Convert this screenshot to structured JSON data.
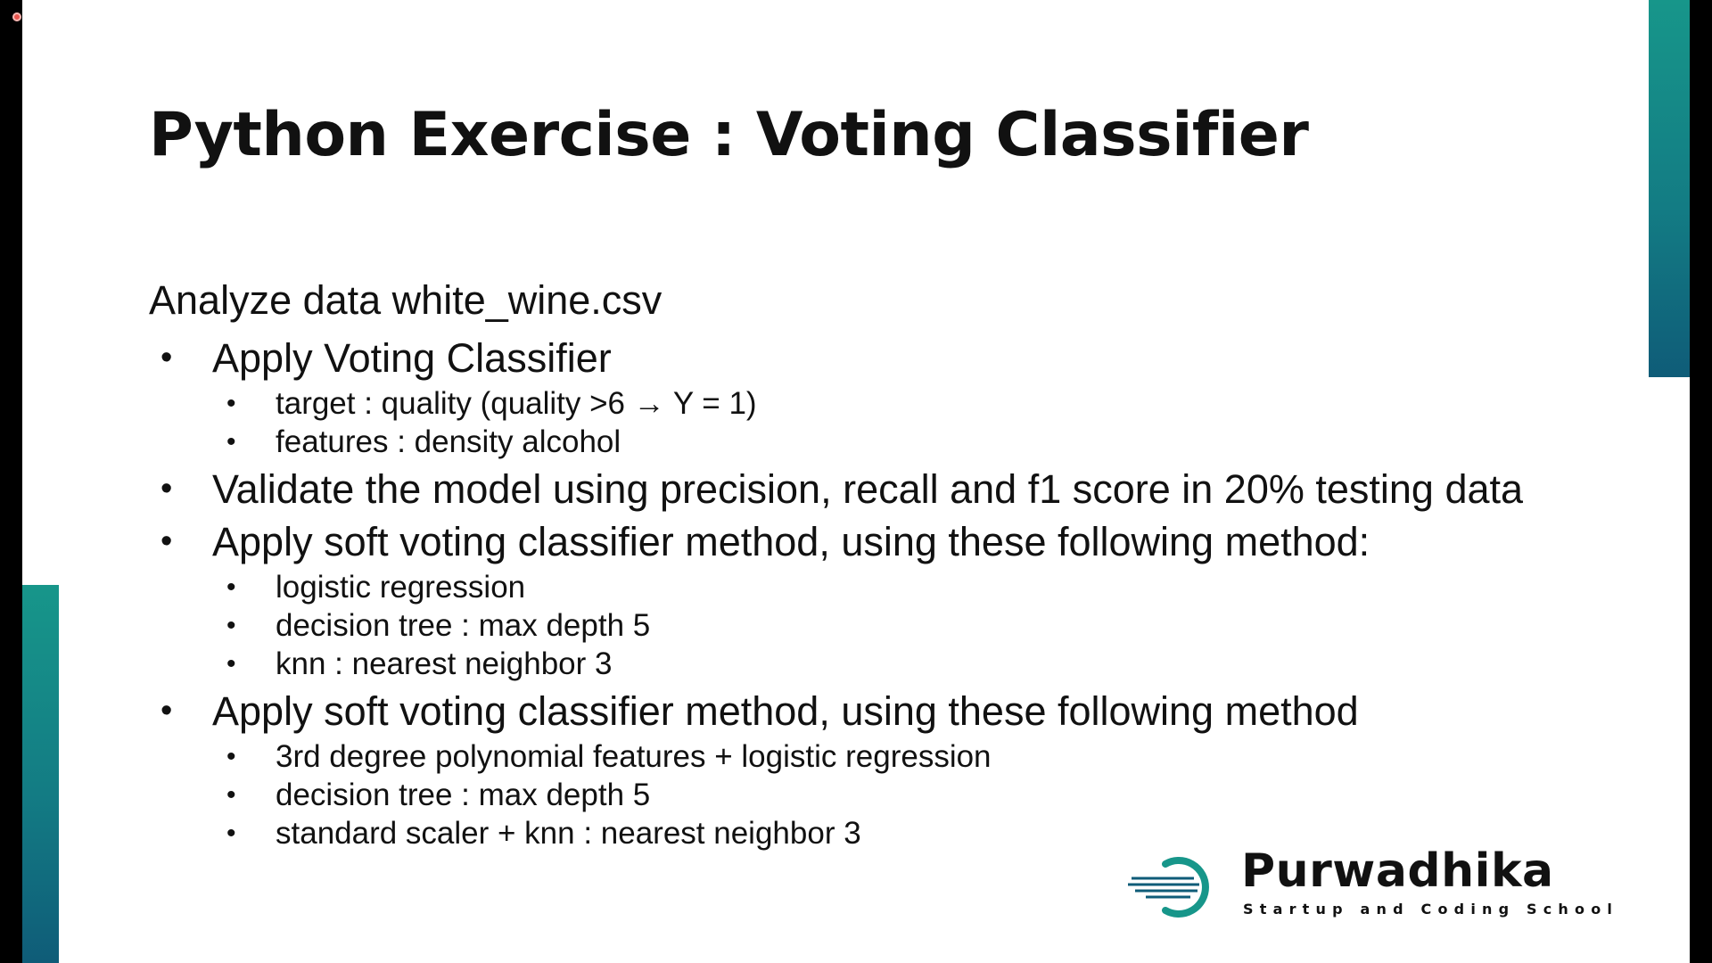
{
  "slide": {
    "title": "Python Exercise : Voting Classifier",
    "intro": "Analyze data white_wine.csv",
    "items": [
      {
        "text": "Apply Voting Classifier",
        "subitems": [
          "target : quality (quality >6 → Y = 1)",
          "features : density alcohol"
        ]
      },
      {
        "text": "Validate the model using precision, recall and f1 score in 20% testing data",
        "subitems": []
      },
      {
        "text": "Apply soft voting classifier method, using these following method:",
        "subitems": [
          "logistic regression",
          "decision tree : max depth 5",
          "knn : nearest neighbor 3"
        ]
      },
      {
        "text": "Apply soft voting classifier method, using these following method",
        "subitems": [
          "3rd degree polynomial features + logistic regression",
          "decision tree : max depth 5",
          "standard scaler + knn : nearest neighbor 3"
        ]
      }
    ],
    "bullet_glyph": "•"
  },
  "logo": {
    "name": "Purwadhika",
    "tagline": "Startup and Coding School"
  },
  "colors": {
    "accent_teal": "#17968a",
    "accent_deep": "#0f5c78",
    "text": "#111111",
    "recording_dot": "#e8554e"
  },
  "icons": {
    "recording": "record-dot-icon",
    "logo_mark": "purwadhika-logo-icon"
  }
}
